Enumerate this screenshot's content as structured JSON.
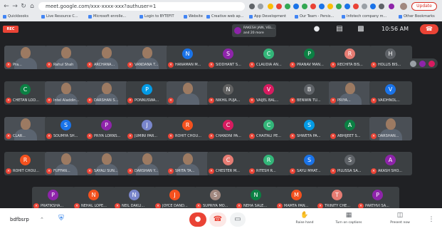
{
  "browser": {
    "url": "meet.google.com/xxx-xxxx-xxx?authuser=1",
    "update_label": "Update",
    "bookmarks": [
      {
        "label": "Quickbooks",
        "color": "#ea4335"
      },
      {
        "label": "Live Resource C...",
        "color": "#1a73e8"
      },
      {
        "label": "Microsoft enrolle...",
        "color": "#34a853"
      },
      {
        "label": "Login to BYTEFIT",
        "color": "#fbbc04"
      },
      {
        "label": "Website",
        "color": "#9aa0a6"
      },
      {
        "label": "Creative web ap...",
        "color": "#1a73e8"
      },
      {
        "label": "App Development",
        "color": "#34a853"
      },
      {
        "label": "Our Team - Persis...",
        "color": "#ea4335"
      },
      {
        "label": "Infotech company m...",
        "color": "#1a73e8"
      },
      {
        "label": "Other Bookmarks",
        "color": "#fbbc04"
      }
    ]
  },
  "meet": {
    "rec_label": "REC",
    "presenter_text": "RAKESH JAIN, VEL... and 20 more",
    "clock": "10:56 AM",
    "participants": [
      {
        "name": "Pra...",
        "initial": "",
        "color": "",
        "video": true
      },
      {
        "name": "Rahul Shah",
        "initial": "",
        "color": "",
        "video": true
      },
      {
        "name": "ARCHANA...",
        "initial": "",
        "color": "",
        "video": true
      },
      {
        "name": "VANDANA T...",
        "initial": "",
        "color": "",
        "video": true
      },
      {
        "name": "HANAMAN M...",
        "initial": "N",
        "color": "#1a73e8",
        "video": false
      },
      {
        "name": "SIDDHANT S...",
        "initial": "S",
        "color": "#8e24aa",
        "video": false
      },
      {
        "name": "CLAUDIA AN...",
        "initial": "C",
        "color": "#33b679",
        "video": false
      },
      {
        "name": "PRANAV MAN...",
        "initial": "P",
        "color": "#0b8043",
        "video": false
      },
      {
        "name": "RECHITA BIS...",
        "initial": "R",
        "color": "#e67c73",
        "video": false
      },
      {
        "name": "HOLLIS BIS...",
        "initial": "H",
        "color": "#5f6368",
        "video": false
      },
      {
        "name": "CHETAN LOD...",
        "initial": "C",
        "color": "#0b8043",
        "video": false
      },
      {
        "name": "Intel Aladdin...",
        "initial": "",
        "color": "",
        "video": true
      },
      {
        "name": "DARSHAN S...",
        "initial": "",
        "color": "",
        "video": true
      },
      {
        "name": "PONNUSWA...",
        "initial": "P",
        "color": "#039be5",
        "video": false
      },
      {
        "name": "",
        "initial": "",
        "color": "",
        "video": true
      },
      {
        "name": "NIKHIL PUJA...",
        "initial": "N",
        "color": "#616161",
        "video": false
      },
      {
        "name": "VAIJEL BAL...",
        "initial": "V",
        "color": "#d81b60",
        "video": false
      },
      {
        "name": "BENWIN TU...",
        "initial": "B",
        "color": "#5f6368",
        "video": false
      },
      {
        "name": "PRIYA...",
        "initial": "",
        "color": "",
        "video": true
      },
      {
        "name": "VAIDHNOL...",
        "initial": "V",
        "color": "#1a73e8",
        "video": false
      },
      {
        "name": "CLAR...",
        "initial": "",
        "color": "",
        "video": true
      },
      {
        "name": "SOUMYA SH...",
        "initial": "S",
        "color": "#1a73e8",
        "video": false
      },
      {
        "name": "PRIYA LORNS...",
        "initial": "P",
        "color": "#8e24aa",
        "video": false
      },
      {
        "name": "JUMINI PAR...",
        "initial": "J",
        "color": "#7986cb",
        "video": false
      },
      {
        "name": "ROHIT CHOU...",
        "initial": "R",
        "color": "#f4511e",
        "video": false
      },
      {
        "name": "CHANDNI PA...",
        "initial": "C",
        "color": "#d81b60",
        "video": false
      },
      {
        "name": "CHAITALI PE...",
        "initial": "C",
        "color": "#33b679",
        "video": false
      },
      {
        "name": "SHWETA PA...",
        "initial": "S",
        "color": "#039be5",
        "video": false
      },
      {
        "name": "ABHIJEET S...",
        "initial": "A",
        "color": "#0b8043",
        "video": false
      },
      {
        "name": "DARSHAN...",
        "initial": "",
        "color": "",
        "video": true
      },
      {
        "name": "ROHIT CHOU...",
        "initial": "R",
        "color": "#f4511e",
        "video": false
      },
      {
        "name": "FUFFAN...",
        "initial": "",
        "color": "",
        "video": true
      },
      {
        "name": "SAYALI SUN...",
        "initial": "",
        "color": "",
        "video": true
      },
      {
        "name": "DARSHAN Y...",
        "initial": "",
        "color": "",
        "video": true
      },
      {
        "name": "SMITA TA...",
        "initial": "",
        "color": "",
        "video": true
      },
      {
        "name": "CHESTER M...",
        "initial": "C",
        "color": "#e67c73",
        "video": false
      },
      {
        "name": "RITESH R...",
        "initial": "R",
        "color": "#33b679",
        "video": false
      },
      {
        "name": "SAYLI MHAT...",
        "initial": "S",
        "color": "#1a73e8",
        "video": false
      },
      {
        "name": "PILUSSA SA...",
        "initial": "S",
        "color": "#5f6368",
        "video": false
      },
      {
        "name": "AKASH SHO...",
        "initial": "A",
        "color": "#8e24aa",
        "video": false
      },
      {
        "name": "PRATIKSHA...",
        "initial": "P",
        "color": "#8e24aa",
        "video": false
      },
      {
        "name": "NEHAL LOPE...",
        "initial": "N",
        "color": "#f4511e",
        "video": false
      },
      {
        "name": "NEIL DAKLI...",
        "initial": "N",
        "color": "#7986cb",
        "video": false
      },
      {
        "name": "JOYCE DAND...",
        "initial": "J",
        "color": "#f4511e",
        "video": false
      },
      {
        "name": "SUPRIYA MO...",
        "initial": "S",
        "color": "#a1887f",
        "video": false
      },
      {
        "name": "NEHA SALE...",
        "initial": "N",
        "color": "#0b8043",
        "video": false
      },
      {
        "name": "MAMTA PAN...",
        "initial": "M",
        "color": "#f4511e",
        "video": false
      },
      {
        "name": "TRINITY CHE...",
        "initial": "T",
        "color": "#e67c73",
        "video": false
      },
      {
        "name": "PARTHVI SA...",
        "initial": "P",
        "color": "#8e24aa",
        "video": false
      }
    ]
  },
  "bottom": {
    "meeting_code": "bdfbsrp",
    "raise_hand_label": "Raise hand",
    "captions_label": "Turn on captions",
    "present_label": "Present now"
  },
  "colors": {
    "accent": "#1a73e8",
    "danger": "#ea4335",
    "stage": "#202124",
    "tile": "#3c4043"
  }
}
